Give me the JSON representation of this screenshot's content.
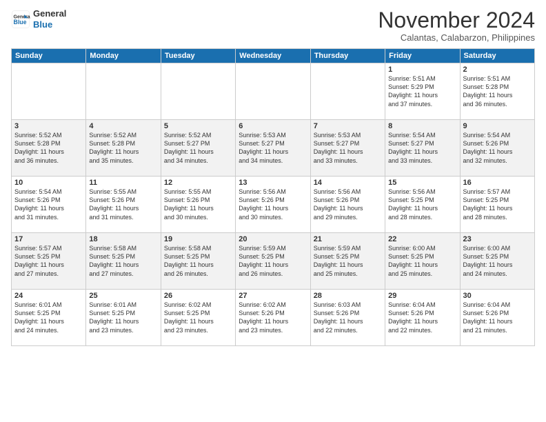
{
  "header": {
    "logo_line1": "General",
    "logo_line2": "Blue",
    "month": "November 2024",
    "location": "Calantas, Calabarzon, Philippines"
  },
  "weekdays": [
    "Sunday",
    "Monday",
    "Tuesday",
    "Wednesday",
    "Thursday",
    "Friday",
    "Saturday"
  ],
  "weeks": [
    [
      {
        "day": "",
        "info": ""
      },
      {
        "day": "",
        "info": ""
      },
      {
        "day": "",
        "info": ""
      },
      {
        "day": "",
        "info": ""
      },
      {
        "day": "",
        "info": ""
      },
      {
        "day": "1",
        "info": "Sunrise: 5:51 AM\nSunset: 5:29 PM\nDaylight: 11 hours\nand 37 minutes."
      },
      {
        "day": "2",
        "info": "Sunrise: 5:51 AM\nSunset: 5:28 PM\nDaylight: 11 hours\nand 36 minutes."
      }
    ],
    [
      {
        "day": "3",
        "info": "Sunrise: 5:52 AM\nSunset: 5:28 PM\nDaylight: 11 hours\nand 36 minutes."
      },
      {
        "day": "4",
        "info": "Sunrise: 5:52 AM\nSunset: 5:28 PM\nDaylight: 11 hours\nand 35 minutes."
      },
      {
        "day": "5",
        "info": "Sunrise: 5:52 AM\nSunset: 5:27 PM\nDaylight: 11 hours\nand 34 minutes."
      },
      {
        "day": "6",
        "info": "Sunrise: 5:53 AM\nSunset: 5:27 PM\nDaylight: 11 hours\nand 34 minutes."
      },
      {
        "day": "7",
        "info": "Sunrise: 5:53 AM\nSunset: 5:27 PM\nDaylight: 11 hours\nand 33 minutes."
      },
      {
        "day": "8",
        "info": "Sunrise: 5:54 AM\nSunset: 5:27 PM\nDaylight: 11 hours\nand 33 minutes."
      },
      {
        "day": "9",
        "info": "Sunrise: 5:54 AM\nSunset: 5:26 PM\nDaylight: 11 hours\nand 32 minutes."
      }
    ],
    [
      {
        "day": "10",
        "info": "Sunrise: 5:54 AM\nSunset: 5:26 PM\nDaylight: 11 hours\nand 31 minutes."
      },
      {
        "day": "11",
        "info": "Sunrise: 5:55 AM\nSunset: 5:26 PM\nDaylight: 11 hours\nand 31 minutes."
      },
      {
        "day": "12",
        "info": "Sunrise: 5:55 AM\nSunset: 5:26 PM\nDaylight: 11 hours\nand 30 minutes."
      },
      {
        "day": "13",
        "info": "Sunrise: 5:56 AM\nSunset: 5:26 PM\nDaylight: 11 hours\nand 30 minutes."
      },
      {
        "day": "14",
        "info": "Sunrise: 5:56 AM\nSunset: 5:26 PM\nDaylight: 11 hours\nand 29 minutes."
      },
      {
        "day": "15",
        "info": "Sunrise: 5:56 AM\nSunset: 5:25 PM\nDaylight: 11 hours\nand 28 minutes."
      },
      {
        "day": "16",
        "info": "Sunrise: 5:57 AM\nSunset: 5:25 PM\nDaylight: 11 hours\nand 28 minutes."
      }
    ],
    [
      {
        "day": "17",
        "info": "Sunrise: 5:57 AM\nSunset: 5:25 PM\nDaylight: 11 hours\nand 27 minutes."
      },
      {
        "day": "18",
        "info": "Sunrise: 5:58 AM\nSunset: 5:25 PM\nDaylight: 11 hours\nand 27 minutes."
      },
      {
        "day": "19",
        "info": "Sunrise: 5:58 AM\nSunset: 5:25 PM\nDaylight: 11 hours\nand 26 minutes."
      },
      {
        "day": "20",
        "info": "Sunrise: 5:59 AM\nSunset: 5:25 PM\nDaylight: 11 hours\nand 26 minutes."
      },
      {
        "day": "21",
        "info": "Sunrise: 5:59 AM\nSunset: 5:25 PM\nDaylight: 11 hours\nand 25 minutes."
      },
      {
        "day": "22",
        "info": "Sunrise: 6:00 AM\nSunset: 5:25 PM\nDaylight: 11 hours\nand 25 minutes."
      },
      {
        "day": "23",
        "info": "Sunrise: 6:00 AM\nSunset: 5:25 PM\nDaylight: 11 hours\nand 24 minutes."
      }
    ],
    [
      {
        "day": "24",
        "info": "Sunrise: 6:01 AM\nSunset: 5:25 PM\nDaylight: 11 hours\nand 24 minutes."
      },
      {
        "day": "25",
        "info": "Sunrise: 6:01 AM\nSunset: 5:25 PM\nDaylight: 11 hours\nand 23 minutes."
      },
      {
        "day": "26",
        "info": "Sunrise: 6:02 AM\nSunset: 5:25 PM\nDaylight: 11 hours\nand 23 minutes."
      },
      {
        "day": "27",
        "info": "Sunrise: 6:02 AM\nSunset: 5:26 PM\nDaylight: 11 hours\nand 23 minutes."
      },
      {
        "day": "28",
        "info": "Sunrise: 6:03 AM\nSunset: 5:26 PM\nDaylight: 11 hours\nand 22 minutes."
      },
      {
        "day": "29",
        "info": "Sunrise: 6:04 AM\nSunset: 5:26 PM\nDaylight: 11 hours\nand 22 minutes."
      },
      {
        "day": "30",
        "info": "Sunrise: 6:04 AM\nSunset: 5:26 PM\nDaylight: 11 hours\nand 21 minutes."
      }
    ]
  ]
}
